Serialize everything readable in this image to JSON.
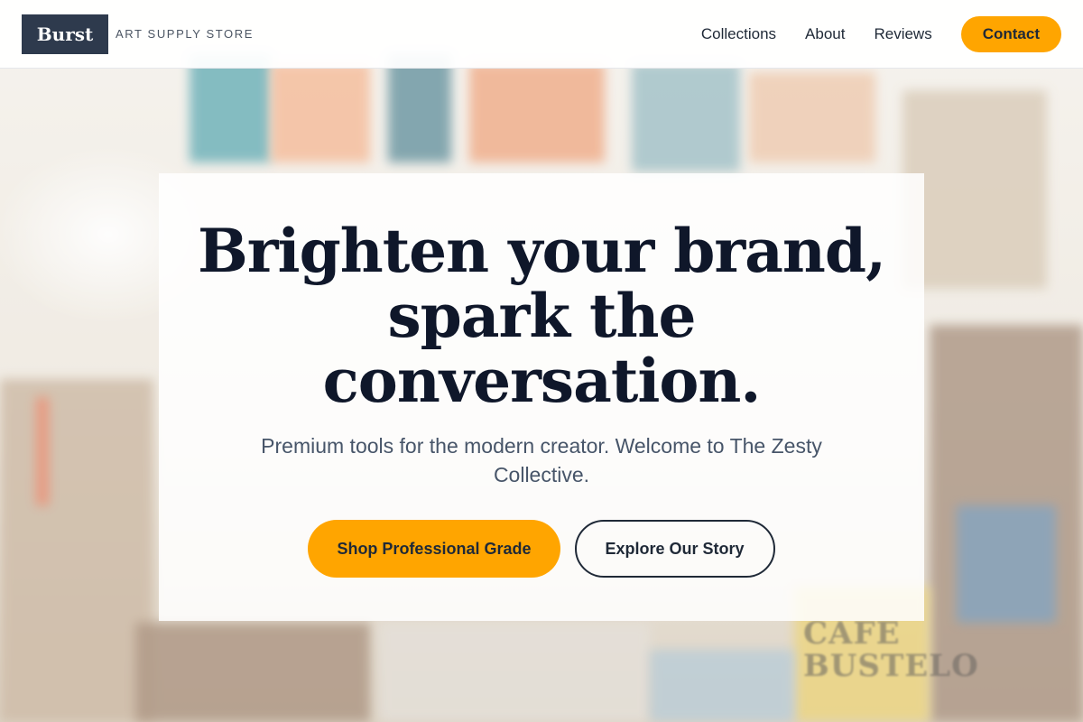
{
  "header": {
    "logo_text": "Burst",
    "tagline": "ART SUPPLY STORE",
    "nav": [
      {
        "label": "Collections"
      },
      {
        "label": "About"
      },
      {
        "label": "Reviews"
      }
    ],
    "contact_label": "Contact"
  },
  "hero": {
    "title": "Brighten your brand, spark the conversation.",
    "subtitle": "Premium tools for the modern creator. Welcome to The Zesty Collective.",
    "primary_cta": "Shop Professional Grade",
    "secondary_cta": "Explore Our Story"
  },
  "background": {
    "image_text": "CAFE BUSTELO"
  },
  "colors": {
    "accent": "#ffa500",
    "logo_bg": "#2e3a4d",
    "heading": "#0f172a"
  }
}
